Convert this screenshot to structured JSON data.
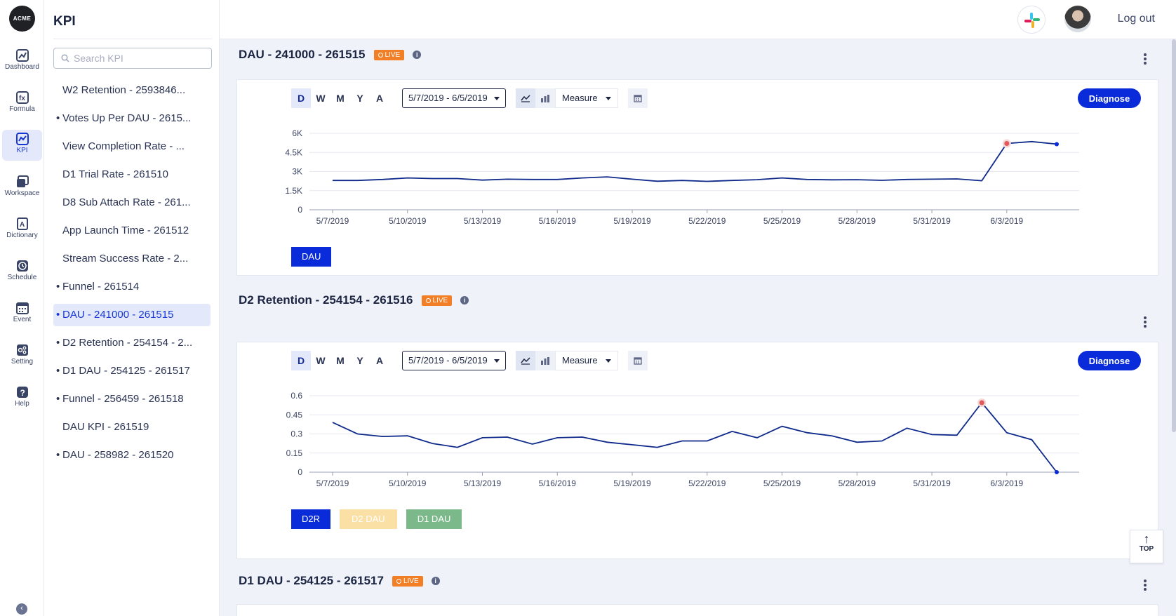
{
  "app": {
    "logo_text": "ACME",
    "page_title": "KPI",
    "logout_label": "Log out"
  },
  "nav": [
    {
      "label": "Dashboard",
      "icon": "dashboard-icon"
    },
    {
      "label": "Formula",
      "icon": "formula-icon"
    },
    {
      "label": "KPI",
      "icon": "kpi-icon"
    },
    {
      "label": "Workspace",
      "icon": "workspace-icon"
    },
    {
      "label": "Dictionary",
      "icon": "dictionary-icon"
    },
    {
      "label": "Schedule",
      "icon": "schedule-icon"
    },
    {
      "label": "Event",
      "icon": "event-icon"
    },
    {
      "label": "Setting",
      "icon": "setting-icon"
    },
    {
      "label": "Help",
      "icon": "help-icon"
    }
  ],
  "search": {
    "placeholder": "Search KPI"
  },
  "kpi_list": [
    {
      "label": "W2 Retention - 2593846...",
      "dot": false
    },
    {
      "label": "Votes Up Per DAU - 2615...",
      "dot": true
    },
    {
      "label": "View Completion Rate - ...",
      "dot": false
    },
    {
      "label": "D1 Trial Rate - 261510",
      "dot": false
    },
    {
      "label": "D8 Sub Attach Rate - 261...",
      "dot": false
    },
    {
      "label": "App Launch Time - 261512",
      "dot": false
    },
    {
      "label": "Stream Success Rate - 2...",
      "dot": false
    },
    {
      "label": "Funnel - 261514",
      "dot": true
    },
    {
      "label": "DAU - 241000 - 261515",
      "dot": true
    },
    {
      "label": "D2 Retention - 254154 - 2...",
      "dot": true
    },
    {
      "label": "D1 DAU - 254125 - 261517",
      "dot": true
    },
    {
      "label": "Funnel - 256459 - 261518",
      "dot": true
    },
    {
      "label": "DAU KPI - 261519",
      "dot": false
    },
    {
      "label": "DAU - 258982 - 261520",
      "dot": true
    }
  ],
  "common": {
    "granularity": [
      "D",
      "W",
      "M",
      "Y",
      "A"
    ],
    "date_range": "5/7/2019 - 6/5/2019",
    "measure_label": "Measure",
    "diagnose_label": "Diagnose",
    "live_label": "LIVE",
    "top_label": "TOP"
  },
  "cards": [
    {
      "title": "DAU - 241000 - 261515"
    },
    {
      "title": "D2 Retention - 254154 - 261516"
    },
    {
      "title": "D1 DAU - 254125 - 261517"
    }
  ],
  "chart_data": [
    {
      "type": "line",
      "title": "DAU - 241000 - 261515",
      "x_ticks": [
        "5/7/2019",
        "5/10/2019",
        "5/13/2019",
        "5/16/2019",
        "5/19/2019",
        "5/22/2019",
        "5/25/2019",
        "5/28/2019",
        "5/31/2019",
        "6/3/2019"
      ],
      "y_ticks": [
        "6K",
        "4.5K",
        "3K",
        "1.5K",
        "0"
      ],
      "ylim": [
        0,
        6000
      ],
      "legend": [
        {
          "name": "DAU",
          "color": "#0a2bd9"
        }
      ],
      "series": [
        {
          "name": "DAU",
          "color": "#0f2a8a",
          "values": [
            2300,
            2300,
            2380,
            2500,
            2450,
            2450,
            2330,
            2400,
            2380,
            2380,
            2500,
            2580,
            2400,
            2240,
            2300,
            2230,
            2300,
            2360,
            2500,
            2380,
            2350,
            2360,
            2310,
            2380,
            2400,
            2420,
            2280,
            5200,
            5350,
            5150
          ]
        }
      ],
      "anomaly_index": 27
    },
    {
      "type": "line",
      "title": "D2 Retention - 254154 - 261516",
      "x_ticks": [
        "5/7/2019",
        "5/10/2019",
        "5/13/2019",
        "5/16/2019",
        "5/19/2019",
        "5/22/2019",
        "5/25/2019",
        "5/28/2019",
        "5/31/2019",
        "6/3/2019"
      ],
      "y_ticks": [
        "0.6",
        "0.45",
        "0.3",
        "0.15",
        "0"
      ],
      "ylim": [
        0,
        0.6
      ],
      "legend": [
        {
          "name": "D2R",
          "color": "#0a2bd9"
        },
        {
          "name": "D2 DAU",
          "color": "#fbe0a6"
        },
        {
          "name": "D1 DAU",
          "color": "#7cb98a"
        }
      ],
      "series": [
        {
          "name": "D2R",
          "color": "#0f2a8a",
          "values": [
            0.39,
            0.3,
            0.28,
            0.285,
            0.225,
            0.195,
            0.27,
            0.275,
            0.22,
            0.27,
            0.275,
            0.235,
            0.215,
            0.195,
            0.245,
            0.245,
            0.32,
            0.27,
            0.36,
            0.31,
            0.285,
            0.235,
            0.245,
            0.345,
            0.295,
            0.29,
            0.545,
            0.31,
            0.255,
            0.0
          ]
        }
      ],
      "anomaly_index": 26
    }
  ]
}
